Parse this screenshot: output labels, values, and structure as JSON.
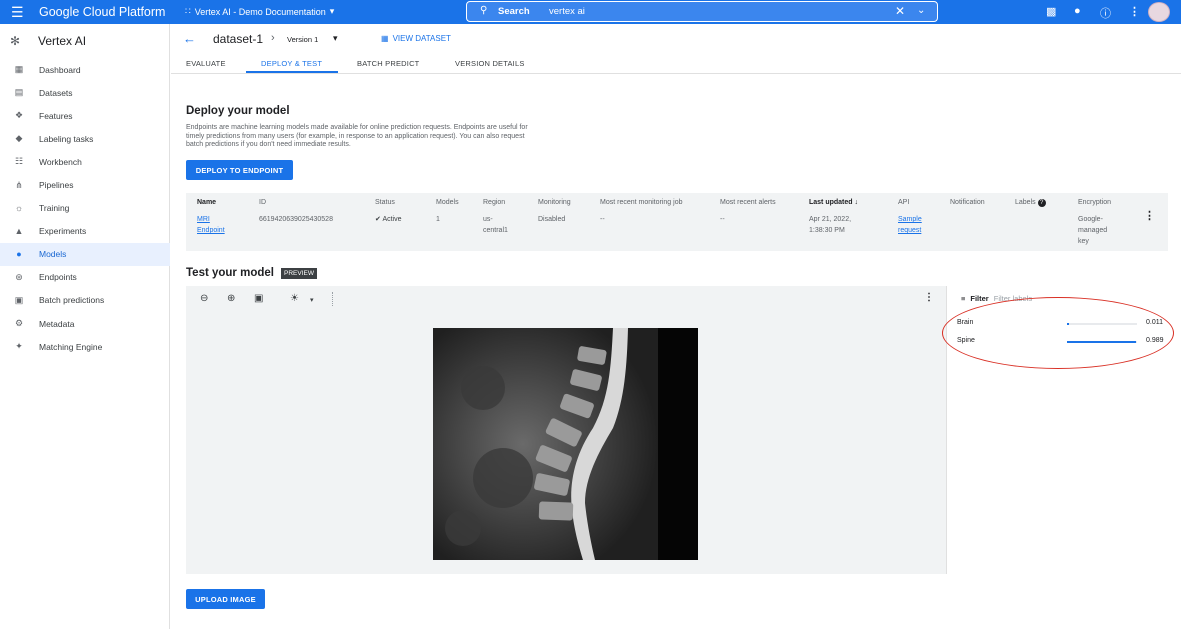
{
  "topbar": {
    "menu_icon": "menu-icon",
    "brand": "Google Cloud Platform",
    "project": "Vertex AI - Demo Documentation",
    "search_label": "Search",
    "search_value": "vertex ai",
    "icons": [
      "cloud-shell-icon",
      "notifications-icon",
      "help-icon",
      "more-vert-icon"
    ]
  },
  "sidebar": {
    "product": "Vertex AI",
    "items": [
      {
        "label": "Dashboard",
        "icon": "dashboard-icon"
      },
      {
        "label": "Datasets",
        "icon": "datasets-icon"
      },
      {
        "label": "Features",
        "icon": "features-icon"
      },
      {
        "label": "Labeling tasks",
        "icon": "label-icon"
      },
      {
        "label": "Workbench",
        "icon": "workbench-icon"
      },
      {
        "label": "Pipelines",
        "icon": "pipelines-icon"
      },
      {
        "label": "Training",
        "icon": "training-icon"
      },
      {
        "label": "Experiments",
        "icon": "experiments-icon"
      },
      {
        "label": "Models",
        "icon": "models-icon",
        "active": true
      },
      {
        "label": "Endpoints",
        "icon": "endpoints-icon"
      },
      {
        "label": "Batch predictions",
        "icon": "batch-icon"
      },
      {
        "label": "Metadata",
        "icon": "metadata-icon"
      },
      {
        "label": "Matching Engine",
        "icon": "matching-icon"
      }
    ]
  },
  "header": {
    "title": "dataset-1",
    "version": "Version 1",
    "view_dataset": "VIEW DATASET"
  },
  "tabs": [
    "EVALUATE",
    "DEPLOY & TEST",
    "BATCH PREDICT",
    "VERSION DETAILS"
  ],
  "active_tab": "DEPLOY & TEST",
  "deploy": {
    "heading": "Deploy your model",
    "description": "Endpoints are machine learning models made available for online prediction requests. Endpoints are useful for timely predictions from many users (for example, in response to an application request). You can also request batch predictions if you don't need immediate results.",
    "button": "DEPLOY TO ENDPOINT"
  },
  "table": {
    "columns": [
      "Name",
      "ID",
      "Status",
      "Models",
      "Region",
      "Monitoring",
      "Most recent monitoring job",
      "Most recent alerts",
      "Last updated",
      "API",
      "Notification",
      "Labels",
      "Encryption"
    ],
    "row": {
      "name_line1": "MRI",
      "name_line2": "Endpoint",
      "id": "6619420639025430528",
      "status": "Active",
      "models": "1",
      "region_line1": "us-",
      "region_line2": "central1",
      "monitoring": "Disabled",
      "recent_job": "--",
      "recent_alerts": "--",
      "updated_line1": "Apr 21, 2022,",
      "updated_line2": "1:38:30 PM",
      "api_line1": "Sample",
      "api_line2": "request",
      "encryption_line1": "Google-",
      "encryption_line2": "managed",
      "encryption_line3": "key"
    }
  },
  "test": {
    "heading": "Test your model",
    "badge": "PREVIEW",
    "filter_label": "Filter",
    "filter_placeholder": "Filter labels",
    "predictions": [
      {
        "label": "Brain",
        "score": "0.011",
        "fraction": 0.011
      },
      {
        "label": "Spine",
        "score": "0.989",
        "fraction": 0.989
      }
    ],
    "upload_button": "UPLOAD IMAGE"
  },
  "colors": {
    "accent": "#1a73e8",
    "highlight": "#d93025"
  }
}
